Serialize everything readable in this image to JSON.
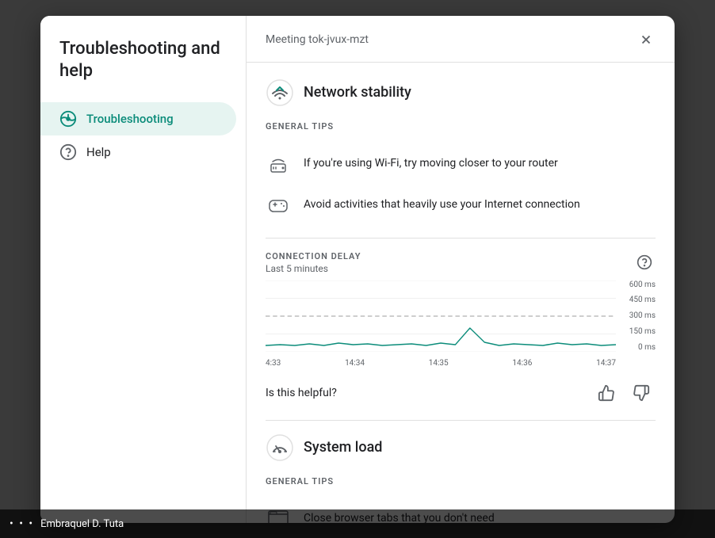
{
  "modal": {
    "meeting_id": "Meeting tok-jvux-mzt",
    "close_label": "×"
  },
  "sidebar": {
    "title": "Troubleshooting and help",
    "items": [
      {
        "id": "troubleshooting",
        "label": "Troubleshooting",
        "active": true
      },
      {
        "id": "help",
        "label": "Help",
        "active": false
      }
    ]
  },
  "network_stability": {
    "title": "Network stability",
    "general_tips_label": "GENERAL TIPS",
    "tips": [
      {
        "text": "If you're using Wi-Fi, try moving closer to your router"
      },
      {
        "text": "Avoid activities that heavily use your Internet connection"
      }
    ]
  },
  "connection_delay": {
    "title": "CONNECTION DELAY",
    "subtitle": "Last 5 minutes",
    "y_labels": [
      "600 ms",
      "450 ms",
      "300 ms",
      "150 ms",
      "0 ms"
    ],
    "x_labels": [
      "4:33",
      "14:34",
      "14:35",
      "14:36",
      "14:37"
    ],
    "threshold_label": "300 ms"
  },
  "helpful": {
    "text": "Is this helpful?",
    "thumbup_label": "Thumbs up",
    "thumbdown_label": "Thumbs down"
  },
  "system_load": {
    "title": "System load",
    "general_tips_label": "GENERAL TIPS",
    "tips": [
      {
        "text": "Close browser tabs that you don't need"
      }
    ]
  },
  "bottom_bar": {
    "dots": "• • •",
    "name": "Embraquel D. Tuta"
  },
  "colors": {
    "active_bg": "#e6f4f1",
    "active_text": "#0b8c7a",
    "chart_line": "#0b8c7a",
    "chart_threshold": "#9e9e9e"
  }
}
